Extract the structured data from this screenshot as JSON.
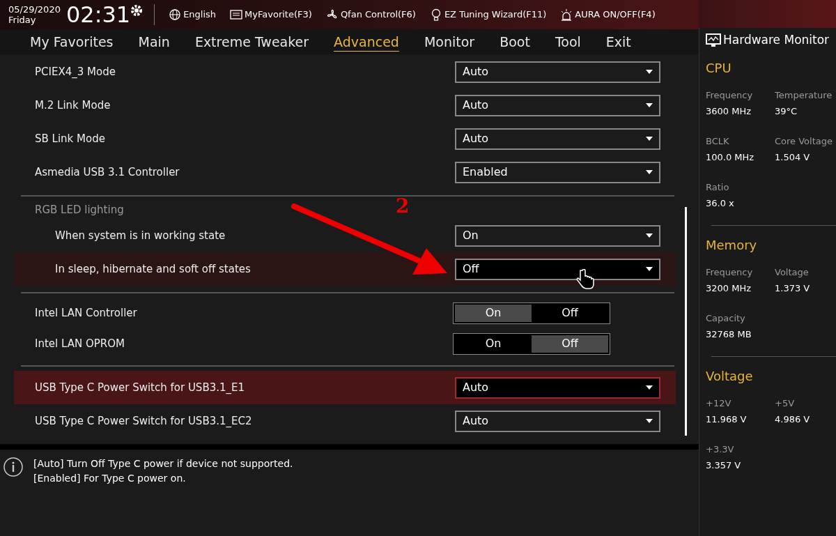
{
  "top_bar": {
    "date": "05/29/2020",
    "day": "Friday",
    "time": "02:31",
    "items": [
      {
        "kind": "globe",
        "label": "English"
      },
      {
        "kind": "star",
        "label": "MyFavorite(F3)"
      },
      {
        "kind": "fan",
        "label": "Qfan Control(F6)"
      },
      {
        "kind": "bulb",
        "label": "EZ Tuning Wizard(F11)"
      },
      {
        "kind": "aura",
        "label": "AURA ON/OFF(F4)"
      }
    ]
  },
  "tabs": [
    {
      "label": "My Favorites",
      "selected": false
    },
    {
      "label": "Main",
      "selected": false
    },
    {
      "label": "Extreme Tweaker",
      "selected": false
    },
    {
      "label": "Advanced",
      "selected": true
    },
    {
      "label": "Monitor",
      "selected": false
    },
    {
      "label": "Boot",
      "selected": false
    },
    {
      "label": "Tool",
      "selected": false
    },
    {
      "label": "Exit",
      "selected": false
    }
  ],
  "settings": [
    {
      "kind": "dropdown",
      "label": "PCIEX4_3 Mode",
      "value": "Auto",
      "selected": false,
      "hovered": false
    },
    {
      "kind": "dropdown",
      "label": "M.2 Link Mode",
      "value": "Auto",
      "selected": false,
      "hovered": false
    },
    {
      "kind": "dropdown",
      "label": "SB Link Mode",
      "value": "Auto",
      "selected": false,
      "hovered": false
    },
    {
      "kind": "dropdown",
      "label": "Asmedia USB 3.1 Controller",
      "value": "Enabled",
      "selected": false,
      "hovered": false
    },
    {
      "kind": "divider"
    },
    {
      "kind": "section",
      "label": "RGB LED lighting",
      "children": [
        {
          "kind": "dropdown",
          "label": "When system is in working state",
          "value": "On",
          "selected": false,
          "hovered": false
        },
        {
          "kind": "dropdown",
          "label": "In sleep, hibernate and soft off states",
          "value": "Off",
          "selected": false,
          "hovered": true
        }
      ]
    },
    {
      "kind": "divider"
    },
    {
      "kind": "toggle",
      "label": "Intel LAN Controller",
      "options": [
        {
          "label": "On",
          "selected": true
        },
        {
          "label": "Off",
          "selected": false
        }
      ],
      "selected": false,
      "hovered": false
    },
    {
      "kind": "toggle",
      "label": "Intel LAN OPROM",
      "options": [
        {
          "label": "On",
          "selected": false
        },
        {
          "label": "Off",
          "selected": true
        }
      ],
      "selected": false,
      "hovered": false
    },
    {
      "kind": "divider"
    },
    {
      "kind": "dropdown",
      "label": "USB Type C Power Switch for USB3.1_E1",
      "value": "Auto",
      "selected": true,
      "hovered": false
    },
    {
      "kind": "dropdown",
      "label": "USB Type C Power Switch for USB3.1_EC2",
      "value": "Auto",
      "selected": false,
      "hovered": false
    }
  ],
  "annotation": {
    "label": "2"
  },
  "help": [
    "[Auto] Turn Off Type C power if device not supported.",
    "[Enabled] For Type C power on."
  ],
  "hardware_monitor": {
    "title": "Hardware Monitor",
    "sections": [
      {
        "title": "CPU",
        "items": [
          {
            "label": "Frequency",
            "value": "3600 MHz"
          },
          {
            "label": "Temperature",
            "value": "39°C"
          },
          {
            "label": "BCLK",
            "value": "100.0 MHz"
          },
          {
            "label": "Core Voltage",
            "value": "1.504 V"
          },
          {
            "label": "Ratio",
            "value": "36.0 x"
          }
        ]
      },
      {
        "title": "Memory",
        "items": [
          {
            "label": "Frequency",
            "value": "3200 MHz"
          },
          {
            "label": "Voltage",
            "value": "1.373 V"
          },
          {
            "label": "Capacity",
            "value": "32768 MB"
          }
        ]
      },
      {
        "title": "Voltage",
        "items": [
          {
            "label": "+12V",
            "value": "11.968 V"
          },
          {
            "label": "+5V",
            "value": "4.986 V"
          },
          {
            "label": "+3.3V",
            "value": "3.357 V"
          }
        ]
      }
    ]
  }
}
